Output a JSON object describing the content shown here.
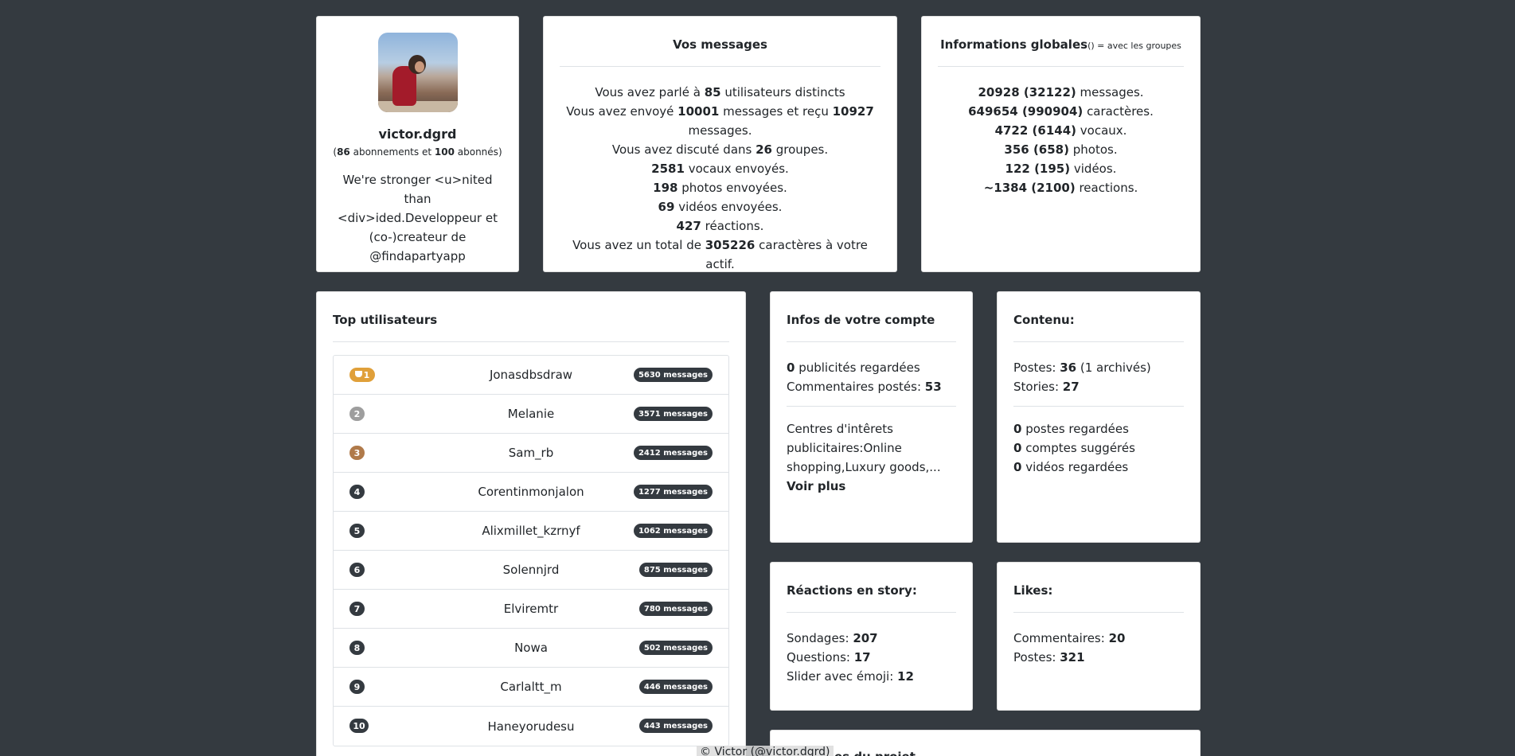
{
  "profile": {
    "username": "victor.dgrd",
    "follows_count": "86",
    "follows_text": "abonnements et",
    "followers_count": "100",
    "followers_text": "abonnés",
    "bio": "We're stronger <u>nited than <div>ided.Developpeur et (co-)createur de @findapartyapp"
  },
  "messages": {
    "title": "Vos messages",
    "l1_a": "Vous avez parlé à ",
    "l1_b": "85",
    "l1_c": " utilisateurs distincts",
    "l2_a": "Vous avez envoyé ",
    "l2_b": "10001",
    "l2_c": " messages et reçu ",
    "l2_d": "10927",
    "l2_e": " messages.",
    "l3_a": "Vous avez discuté dans ",
    "l3_b": "26",
    "l3_c": " groupes.",
    "l4_b": "2581",
    "l4_c": " vocaux envoyés.",
    "l5_b": "198",
    "l5_c": " photos envoyées.",
    "l6_b": "69",
    "l6_c": " vidéos envoyées.",
    "l7_b": "427",
    "l7_c": " réactions.",
    "l8_a": "Vous avez un total de ",
    "l8_b": "305226",
    "l8_c": " caractères à votre actif."
  },
  "global": {
    "title": "Informations globales",
    "note": "() = avec les groupes",
    "rows": [
      {
        "value": "20928 (32122)",
        "label": " messages."
      },
      {
        "value": "649654 (990904)",
        "label": " caractères."
      },
      {
        "value": "4722 (6144)",
        "label": " vocaux."
      },
      {
        "value": "356 (658)",
        "label": " photos."
      },
      {
        "value": "122 (195)",
        "label": " vidéos."
      },
      {
        "value": "~1384 (2100)",
        "label": " reactions."
      }
    ]
  },
  "top": {
    "title": "Top utilisateurs",
    "users": [
      {
        "rank": "1",
        "name": "Jonasdbsdraw",
        "count": "5630 messages"
      },
      {
        "rank": "2",
        "name": "Melanie",
        "count": "3571 messages"
      },
      {
        "rank": "3",
        "name": "Sam_rb",
        "count": "2412 messages"
      },
      {
        "rank": "4",
        "name": "Corentinmonjalon",
        "count": "1277 messages"
      },
      {
        "rank": "5",
        "name": "Alixmillet_kzrnyf",
        "count": "1062 messages"
      },
      {
        "rank": "6",
        "name": "Solennjrd",
        "count": "875 messages"
      },
      {
        "rank": "7",
        "name": "Elviremtr",
        "count": "780 messages"
      },
      {
        "rank": "8",
        "name": "Nowa",
        "count": "502 messages"
      },
      {
        "rank": "9",
        "name": "Carlaltt_m",
        "count": "446 messages"
      },
      {
        "rank": "10",
        "name": "Haneyorudesu",
        "count": "443 messages"
      }
    ]
  },
  "account": {
    "title": "Infos de votre compte",
    "ads_value": "0",
    "ads_label": " publicités regardées",
    "comments_label": "Commentaires postés: ",
    "comments_value": "53",
    "interests": "Centres d'intêrets publicitaires:Online shopping,Luxury goods,...",
    "more": "Voir plus"
  },
  "content": {
    "title": "Contenu:",
    "posts_label": "Postes: ",
    "posts_value": "36",
    "posts_archived": " (1 archivés)",
    "stories_label": "Stories: ",
    "stories_value": "27",
    "viewed_value": "0",
    "viewed_label": " postes regardées",
    "suggested_value": "0",
    "suggested_label": " comptes suggérés",
    "videos_value": "0",
    "videos_label": " vidéos regardées"
  },
  "reactions": {
    "title": "Réactions en story:",
    "polls_label": "Sondages: ",
    "polls_value": "207",
    "questions_label": "Questions: ",
    "questions_value": "17",
    "slider_label": "Slider avec émoji: ",
    "slider_value": "12"
  },
  "likes": {
    "title": "Likes:",
    "comments_label": "Commentaires: ",
    "comments_value": "20",
    "posts_label": "Postes: ",
    "posts_value": "321"
  },
  "project": {
    "title_partial": "es du projet"
  },
  "footer": {
    "text": "© Victor (@victor.dgrd)"
  }
}
